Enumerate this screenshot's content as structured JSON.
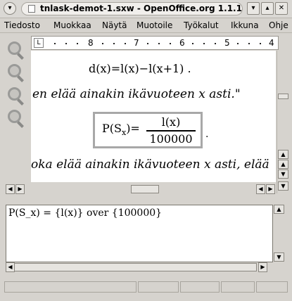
{
  "window": {
    "title": "tnlask-demot-1.sxw - OpenOffice.org 1.1.1",
    "menu_glyph": "▾",
    "min_glyph": "▾",
    "max_glyph": "▴",
    "close_glyph": "✕"
  },
  "menubar": {
    "items": [
      "Tiedosto",
      "Muokkaa",
      "Näytä",
      "Muotoile",
      "Työkalut",
      "Ikkuna",
      "Ohje"
    ]
  },
  "ruler": {
    "corner": "L",
    "numbers": [
      "8",
      "7",
      "6",
      "5",
      "4"
    ]
  },
  "document": {
    "eq1": "d(x)=l(x)−l(x+1) .",
    "line1": "en elää ainakin ikävuoteen x asti.\"",
    "formula": {
      "lhs": "P(S",
      "sub": "x",
      "rhs": ")=",
      "numerator": "l(x)",
      "denominator": "100000"
    },
    "formula_after": ".",
    "line2": "oka elää ainakin ikävuoteen x asti, elää"
  },
  "command": {
    "text": "P(S_x) = {l(x)} over {100000}"
  },
  "scroll": {
    "up": "▲",
    "down": "▼",
    "left": "◀",
    "right": "▶"
  }
}
